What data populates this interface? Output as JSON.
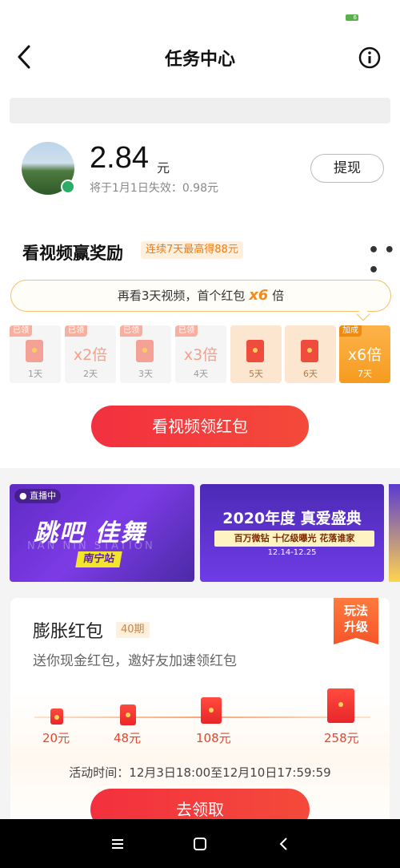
{
  "status_bar": {
    "battery_text": "6"
  },
  "nav": {
    "title": "任务中心"
  },
  "account": {
    "amount": "2.84",
    "unit": "元",
    "expire_text": "将于1月1日失效：0.98元",
    "withdraw_label": "提现"
  },
  "video_task": {
    "title": "看视频赢奖励",
    "badge": "连续7天最高得88元",
    "tip_prefix": "再看3天视频，首个红包",
    "tip_mult": "x6",
    "tip_suffix": "倍",
    "days": [
      {
        "tag": "已领",
        "mult": "",
        "label": "1天",
        "state": "done"
      },
      {
        "tag": "已领",
        "mult": "x2倍",
        "label": "2天",
        "state": "done"
      },
      {
        "tag": "已领",
        "mult": "",
        "label": "3天",
        "state": "done"
      },
      {
        "tag": "已领",
        "mult": "x3倍",
        "label": "4天",
        "state": "done"
      },
      {
        "tag": "",
        "mult": "",
        "label": "5天",
        "state": "future"
      },
      {
        "tag": "",
        "mult": "",
        "label": "6天",
        "state": "future"
      },
      {
        "tag": "加成",
        "mult": "x6倍",
        "label": "7天",
        "state": "last"
      }
    ],
    "cta_label": "看视频领红包"
  },
  "banners": {
    "live_tag": "● 直播中",
    "b1_title": "跳吧 佳舞",
    "b1_ghost": "NAN NIN STATION",
    "b1_city": "南宁站",
    "b2_title": "2020年度 真爱盛典",
    "b2_tags": "百万微钻 十亿级曝光 花落谁家",
    "b2_date": "12.14-12.25"
  },
  "inflate": {
    "title": "膨胀红包",
    "period": "40期",
    "subtitle": "送你现金红包，邀好友加速领红包",
    "play_badge_line1": "玩法",
    "play_badge_line2": "升级",
    "tiers": [
      "20元",
      "48元",
      "108元",
      "258元"
    ],
    "time_text": "活动时间：12月3日18:00至12月10日17:59:59",
    "button_label": "去领取"
  },
  "colors": {
    "accent_red": "#f3303f",
    "orange": "#f58a1c"
  }
}
